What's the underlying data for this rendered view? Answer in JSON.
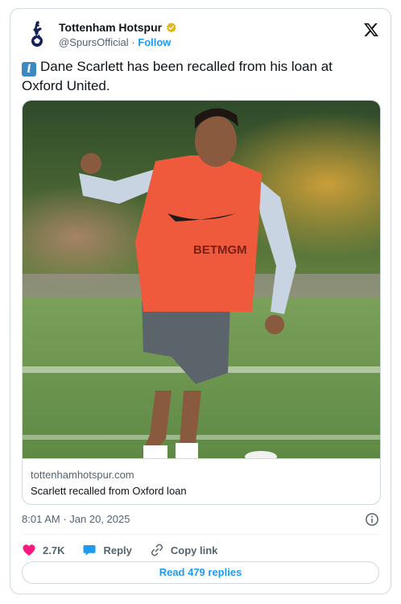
{
  "tweet": {
    "author": {
      "display_name": "Tottenham Hotspur",
      "handle": "@SpursOfficial",
      "separator": "·",
      "follow_label": "Follow",
      "avatar_icon": "spurs-cockerel-icon",
      "verified_icon": "gold-verified-badge-icon",
      "verified_color": "#e2b719"
    },
    "text": "Dane Scarlett has been recalled from his loan at Oxford United.",
    "leading_emoji": "i",
    "media": {
      "link_domain": "tottenhamhotspur.com",
      "link_title": "Scarlett recalled from Oxford loan",
      "photo_bib_text": "BETMGM"
    },
    "timestamp": {
      "time": "8:01 AM",
      "separator": "·",
      "date": "Jan 20, 2025"
    },
    "actions": {
      "likes": "2.7K",
      "reply_label": "Reply",
      "copy_link_label": "Copy link"
    },
    "read_replies_label": "Read 479 replies"
  },
  "colors": {
    "accent": "#1d9bf0",
    "like": "#f91880",
    "text": "#0f1419",
    "muted": "#536471",
    "border": "#cfd9de"
  }
}
